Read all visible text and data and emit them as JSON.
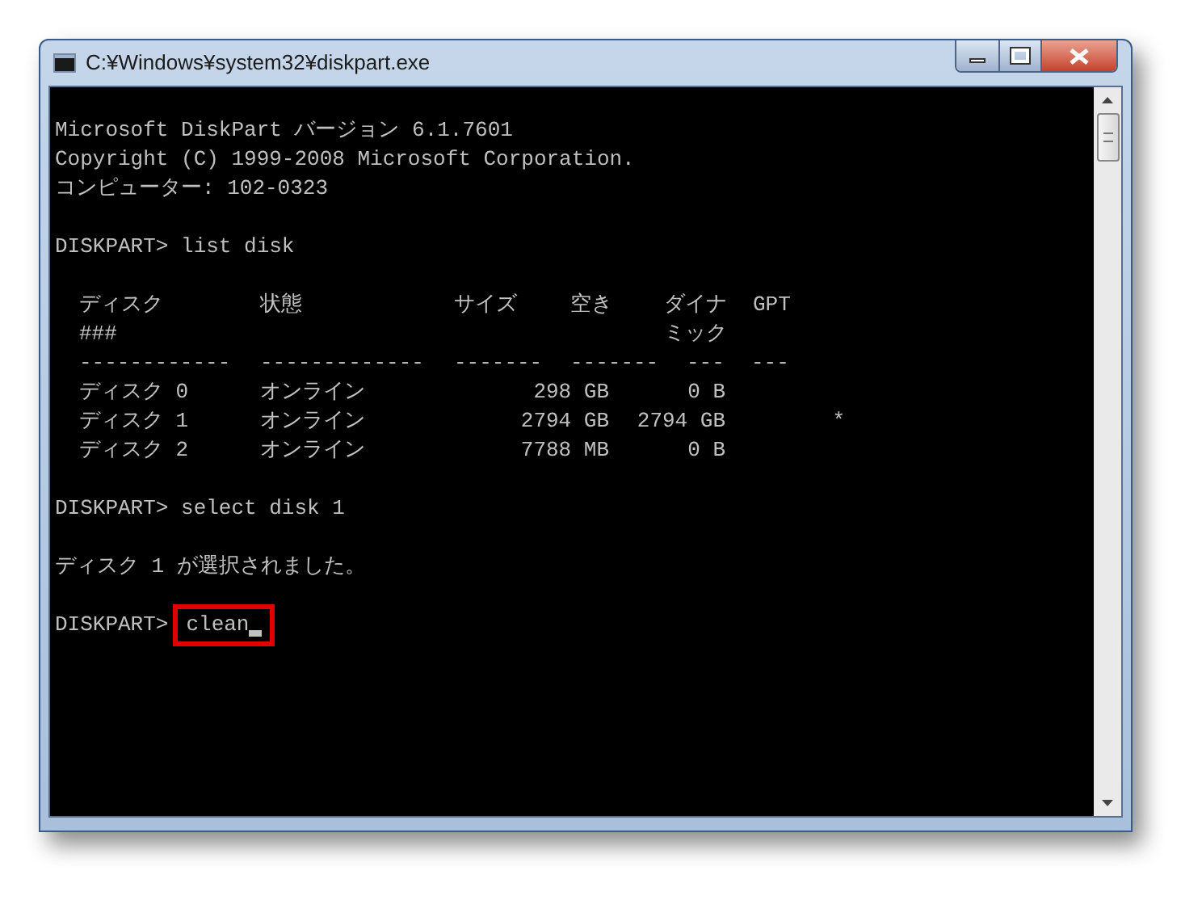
{
  "window": {
    "title": "C:¥Windows¥system32¥diskpart.exe"
  },
  "console": [
    {
      "kind": "text",
      "text": "Microsoft DiskPart バージョン 6.1.7601"
    },
    {
      "kind": "text",
      "text": "Copyright (C) 1999-2008 Microsoft Corporation."
    },
    {
      "kind": "text",
      "text": "コンピューター: 102-0323"
    },
    {
      "kind": "blank"
    },
    {
      "kind": "text",
      "text": "DISKPART> list disk"
    },
    {
      "kind": "blank"
    },
    {
      "kind": "table",
      "columns": [
        {
          "label": "ディスク",
          "label_2": "###"
        },
        {
          "label": "状態"
        },
        {
          "label": "サイズ"
        },
        {
          "label": "空き"
        },
        {
          "label": "ダイナ",
          "label_2": "ミック"
        },
        {
          "label": "GPT"
        }
      ],
      "dashes": [
        "------------",
        "-------------",
        "-------",
        "-------",
        "---",
        "---"
      ],
      "rows": [
        {
          "disk": "ディスク 0",
          "status": "オンライン",
          "size": "298 GB",
          "free": "0 B"
        },
        {
          "disk": "ディスク 1",
          "status": "オンライン",
          "size": "2794 GB",
          "free": "2794 GB",
          "gpt": "*"
        },
        {
          "disk": "ディスク 2",
          "status": "オンライン",
          "size": "7788 MB",
          "free": "0 B"
        }
      ]
    },
    {
      "kind": "blank"
    },
    {
      "kind": "text",
      "text": "DISKPART> select disk 1"
    },
    {
      "kind": "blank"
    },
    {
      "kind": "text",
      "text": "ディスク 1 が選択されました。"
    },
    {
      "kind": "blank"
    },
    {
      "kind": "input",
      "prompt": "DISKPART>",
      "command": "clean",
      "highlighted": true,
      "cursor": true
    }
  ]
}
